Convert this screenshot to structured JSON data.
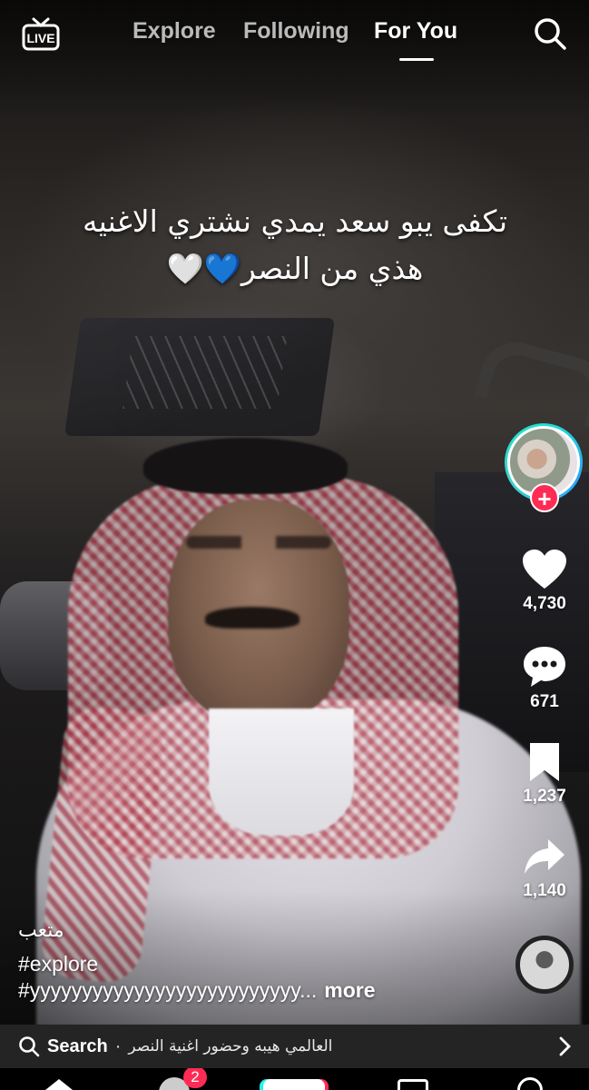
{
  "top_nav": {
    "live_label": "LIVE",
    "tabs": [
      {
        "label": "Explore",
        "active": false
      },
      {
        "label": "Following",
        "active": false
      },
      {
        "label": "For You",
        "active": true
      }
    ],
    "search_icon": "search-icon"
  },
  "video": {
    "caption_line1": "تكفى يبو سعد يمدي نشتري الاغنيه",
    "caption_line2": "هذي من النصر💙🤍"
  },
  "actions": {
    "like_count": "4,730",
    "comment_count": "671",
    "save_count": "1,237",
    "share_count": "1,140"
  },
  "post": {
    "author": "متعب",
    "hashtag_line1": "#explore",
    "hashtag_line2": "#yyyyyyyyyyyyyyyyyyyyyyyyyy...",
    "more_label": "more"
  },
  "search_suggestion": {
    "label": "Search",
    "separator": "·",
    "query": "العالمي هيبه وحضور اغنية النصر"
  },
  "bottom_nav": {
    "inbox_badge": "2"
  },
  "colors": {
    "accent_red": "#fe2c55",
    "accent_cyan": "#25f4ee",
    "search_bar_bg": "#242424"
  }
}
